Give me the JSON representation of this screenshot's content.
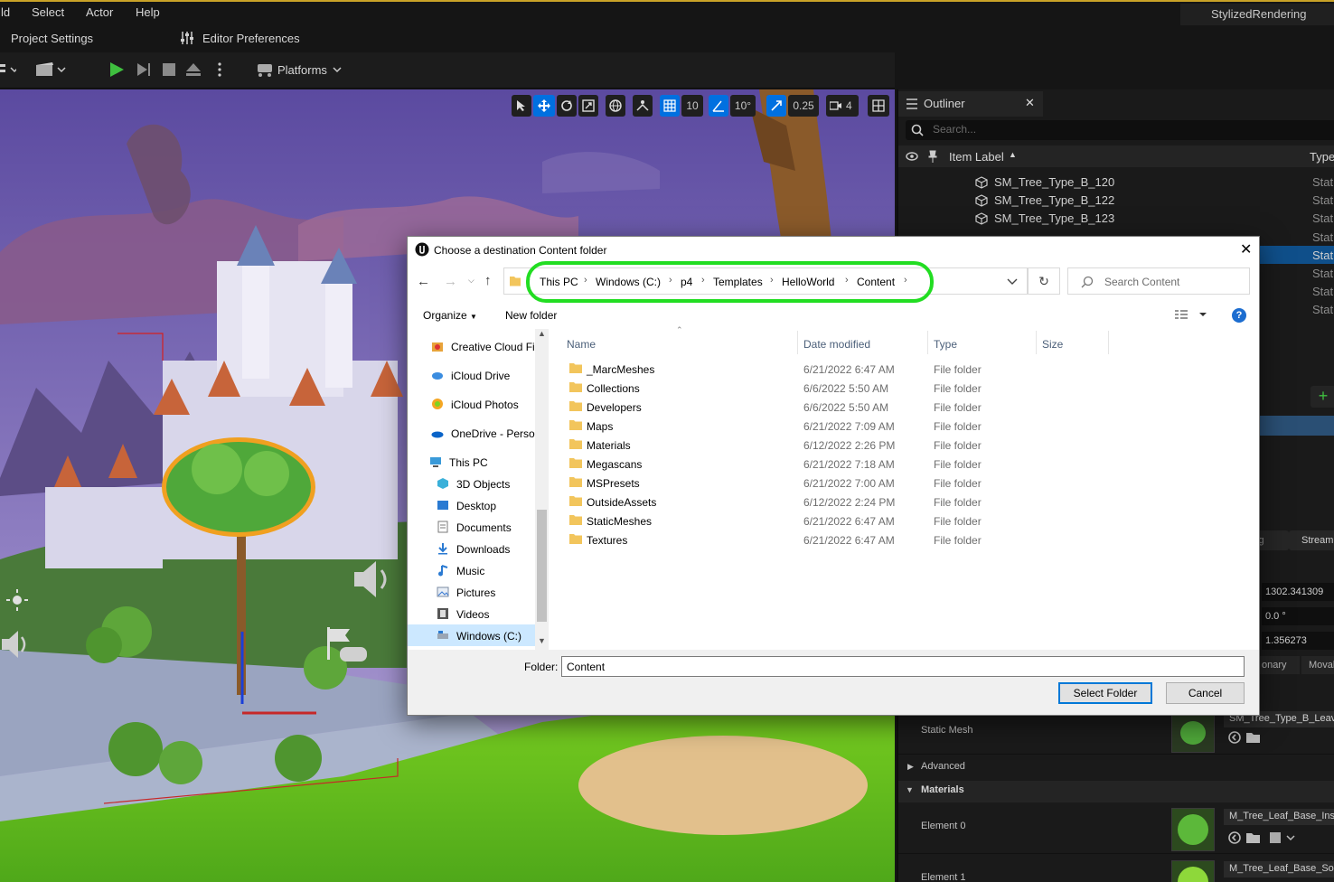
{
  "editor": {
    "menu": [
      "ld",
      "Select",
      "Actor",
      "Help"
    ],
    "project_name": "StylizedRendering",
    "project_settings": "Project Settings",
    "editor_preferences": "Editor Preferences",
    "platforms": "Platforms"
  },
  "viewport_tools": {
    "grid_value": "10",
    "angle_value": "10°",
    "scale_value": "0.25",
    "camera_speed": "4"
  },
  "outliner": {
    "title": "Outliner",
    "search_placeholder": "Search...",
    "column_label": "Item Label",
    "column_type": "Type",
    "rows": [
      {
        "label": "SM_Tree_Type_B_120",
        "type": "Stati"
      },
      {
        "label": "SM_Tree_Type_B_122",
        "type": "Stati"
      },
      {
        "label": "SM_Tree_Type_B_123",
        "type": "Stati"
      }
    ],
    "more_types": [
      "Stati",
      "Stati",
      "Stati",
      "Stati",
      "Stati"
    ]
  },
  "details": {
    "tabs": [
      "ig",
      "Stream"
    ],
    "transform_values": [
      "1302.341309",
      "0.0 °",
      "1.356273"
    ],
    "mobility": [
      "onary",
      "Moval"
    ],
    "static_mesh_label": "Static Mesh",
    "static_mesh_value": "SM_Tree_Type_B_Leav",
    "advanced_label": "Advanced",
    "materials_label": "Materials",
    "element0_label": "Element 0",
    "element0_value": "M_Tree_Leaf_Base_Ins",
    "element1_label": "Element 1",
    "element1_value": "M_Tree_Leaf_Base_So"
  },
  "dialog": {
    "title": "Choose a destination Content folder",
    "breadcrumbs": [
      "This PC",
      "Windows (C:)",
      "p4",
      "Templates",
      "HelloWorld",
      "Content"
    ],
    "search_placeholder": "Search Content",
    "organize": "Organize",
    "new_folder": "New folder",
    "columns": {
      "name": "Name",
      "date": "Date modified",
      "type": "Type",
      "size": "Size"
    },
    "nav": [
      {
        "label": "Creative Cloud Fil",
        "icon": "creative-cloud-icon"
      },
      {
        "label": "iCloud Drive",
        "icon": "icloud-drive-icon"
      },
      {
        "label": "iCloud Photos",
        "icon": "icloud-photos-icon"
      },
      {
        "label": "OneDrive - Persor",
        "icon": "onedrive-icon"
      },
      {
        "label": "This PC",
        "icon": "computer-icon"
      },
      {
        "label": "3D Objects",
        "icon": "3d-objects-icon"
      },
      {
        "label": "Desktop",
        "icon": "desktop-icon"
      },
      {
        "label": "Documents",
        "icon": "documents-icon"
      },
      {
        "label": "Downloads",
        "icon": "downloads-icon"
      },
      {
        "label": "Music",
        "icon": "music-icon"
      },
      {
        "label": "Pictures",
        "icon": "pictures-icon"
      },
      {
        "label": "Videos",
        "icon": "videos-icon"
      },
      {
        "label": "Windows (C:)",
        "icon": "drive-icon"
      }
    ],
    "files": [
      {
        "name": "_MarcMeshes",
        "date": "6/21/2022 6:47 AM",
        "type": "File folder"
      },
      {
        "name": "Collections",
        "date": "6/6/2022 5:50 AM",
        "type": "File folder"
      },
      {
        "name": "Developers",
        "date": "6/6/2022 5:50 AM",
        "type": "File folder"
      },
      {
        "name": "Maps",
        "date": "6/21/2022 7:09 AM",
        "type": "File folder"
      },
      {
        "name": "Materials",
        "date": "6/12/2022 2:26 PM",
        "type": "File folder"
      },
      {
        "name": "Megascans",
        "date": "6/21/2022 7:18 AM",
        "type": "File folder"
      },
      {
        "name": "MSPresets",
        "date": "6/21/2022 7:00 AM",
        "type": "File folder"
      },
      {
        "name": "OutsideAssets",
        "date": "6/12/2022 2:24 PM",
        "type": "File folder"
      },
      {
        "name": "StaticMeshes",
        "date": "6/21/2022 6:47 AM",
        "type": "File folder"
      },
      {
        "name": "Textures",
        "date": "6/21/2022 6:47 AM",
        "type": "File folder"
      }
    ],
    "folder_label": "Folder:",
    "folder_value": "Content",
    "select_button": "Select Folder",
    "cancel_button": "Cancel"
  },
  "colors": {
    "highlight": "#22dd22",
    "ue_accent": "#0070e0",
    "title_strip": "#c9a227"
  }
}
